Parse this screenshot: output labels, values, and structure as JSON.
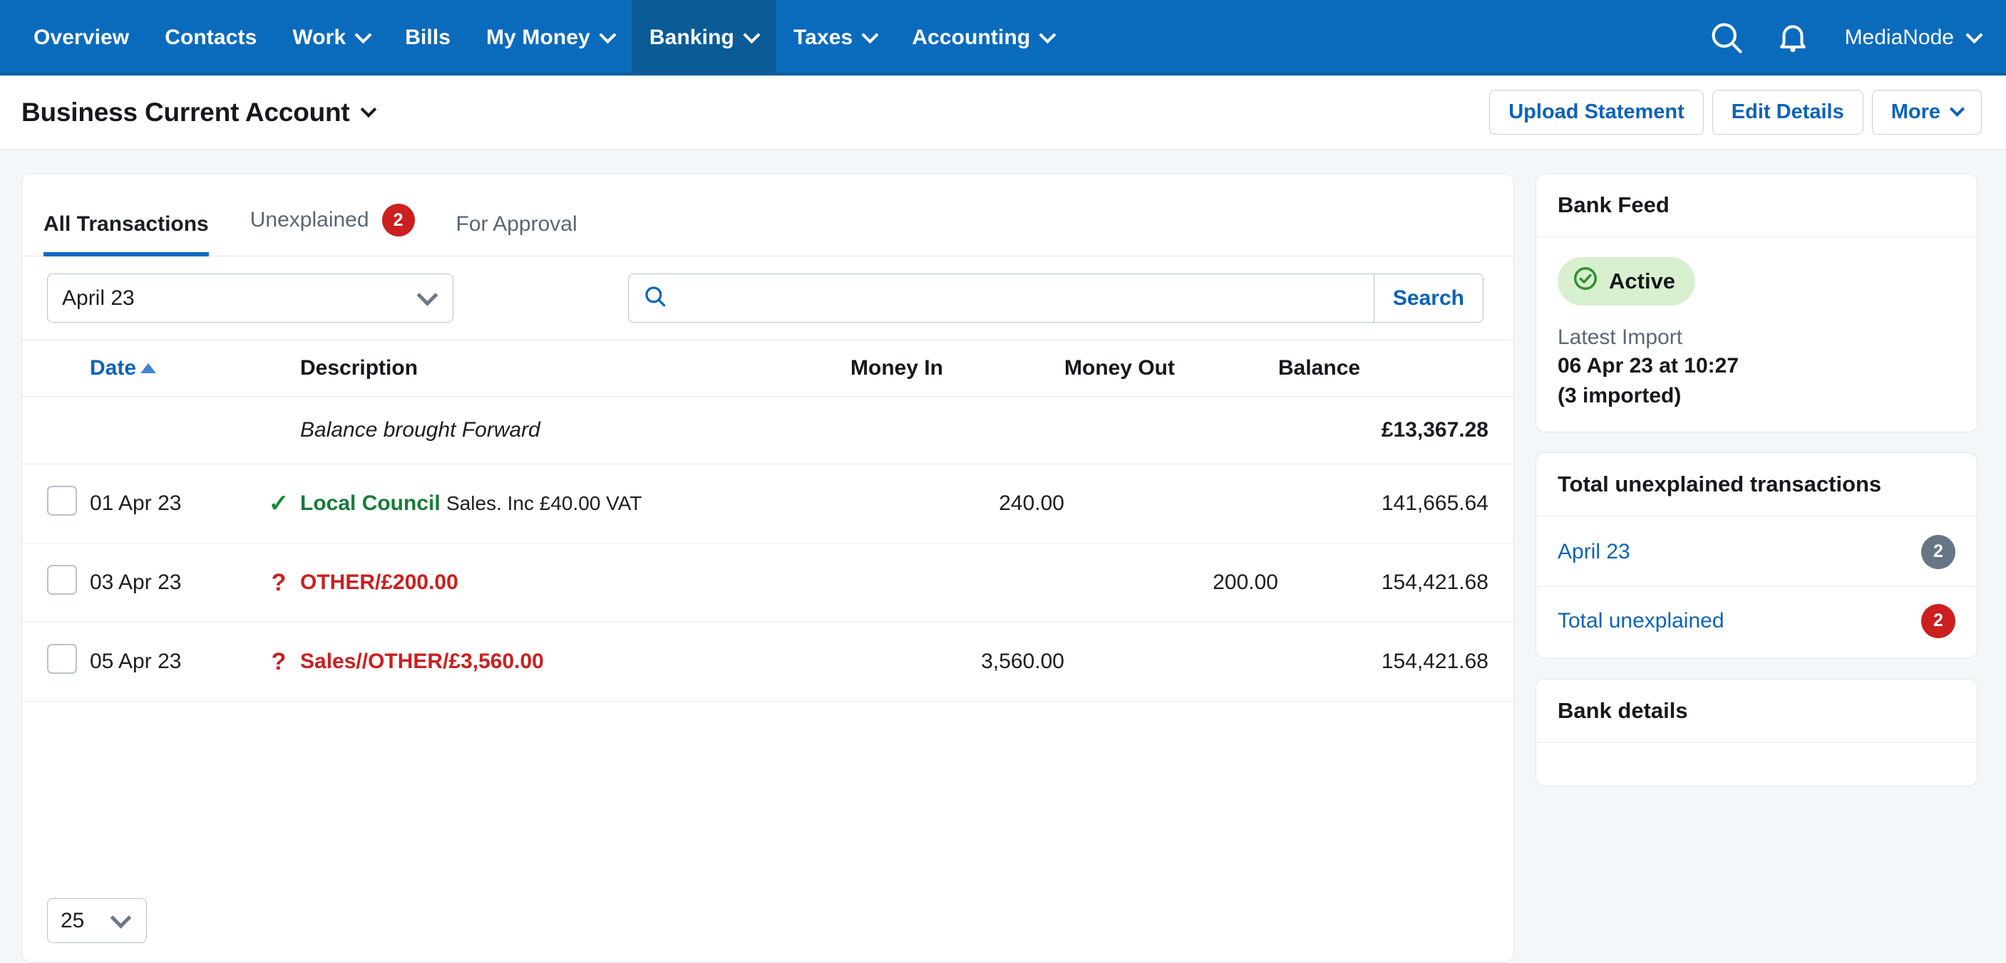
{
  "topnav": {
    "items": [
      {
        "label": "Overview",
        "has_caret": false,
        "active": false
      },
      {
        "label": "Contacts",
        "has_caret": false,
        "active": false
      },
      {
        "label": "Work",
        "has_caret": true,
        "active": false
      },
      {
        "label": "Bills",
        "has_caret": false,
        "active": false
      },
      {
        "label": "My Money",
        "has_caret": true,
        "active": false
      },
      {
        "label": "Banking",
        "has_caret": true,
        "active": true
      },
      {
        "label": "Taxes",
        "has_caret": true,
        "active": false
      },
      {
        "label": "Accounting",
        "has_caret": true,
        "active": false
      }
    ],
    "search_icon": "search-icon",
    "notifications_icon": "bell-icon",
    "org_name": "MediaNode",
    "brand_color": "#0a6bbd",
    "active_color": "#0b5b97"
  },
  "pagehead": {
    "title": "Business Current Account",
    "buttons": [
      {
        "label": "Upload Statement",
        "has_caret": false
      },
      {
        "label": "Edit Details",
        "has_caret": false
      },
      {
        "label": "More",
        "has_caret": true
      }
    ]
  },
  "tabs": [
    {
      "label": "All Transactions",
      "badge": null,
      "active": true
    },
    {
      "label": "Unexplained",
      "badge": "2",
      "active": false
    },
    {
      "label": "For Approval",
      "badge": null,
      "active": false
    }
  ],
  "filters": {
    "period_value": "April 23",
    "period_options": [
      "April 23"
    ],
    "search_value": "",
    "search_placeholder": "",
    "search_button_label": "Search",
    "search_icon": "search-icon"
  },
  "table": {
    "columns": [
      "Date",
      "Description",
      "Money In",
      "Money Out",
      "Balance"
    ],
    "sort_column": "Date",
    "sort_direction": "asc",
    "brought_forward": {
      "label": "Balance brought Forward",
      "balance": "£13,367.28"
    },
    "rows": [
      {
        "date": "01 Apr 23",
        "flag": "tick",
        "desc_primary": "Local Council",
        "desc_secondary": "Sales. Inc £40.00 VAT",
        "desc_color": "green",
        "money_in": "240.00",
        "money_out": "",
        "balance": "141,665.64",
        "checked": false
      },
      {
        "date": "03 Apr 23",
        "flag": "question",
        "desc_primary": "OTHER/£200.00",
        "desc_secondary": "",
        "desc_color": "red",
        "money_in": "",
        "money_out": "200.00",
        "balance": "154,421.68",
        "checked": false
      },
      {
        "date": "05 Apr 23",
        "flag": "question",
        "desc_primary": "Sales//OTHER/£3,560.00",
        "desc_secondary": "",
        "desc_color": "red",
        "money_in": "3,560.00",
        "money_out": "",
        "balance": "154,421.68",
        "checked": false
      }
    ],
    "page_size_value": "25",
    "page_size_options": [
      "25"
    ]
  },
  "sidebar": {
    "bank_feed": {
      "title": "Bank Feed",
      "status_label": "Active",
      "status_icon": "check-circle-icon",
      "status_color": "#d8f0cf",
      "latest_import_label": "Latest Import",
      "latest_import_value": "06 Apr 23 at 10:27",
      "latest_import_count": "(3 imported)"
    },
    "unexplained": {
      "title": "Total unexplained transactions",
      "rows": [
        {
          "label": "April 23",
          "count": "2",
          "badge_style": "grey"
        },
        {
          "label": "Total unexplained",
          "count": "2",
          "badge_style": "red"
        }
      ]
    },
    "bank_details": {
      "title": "Bank details"
    }
  }
}
